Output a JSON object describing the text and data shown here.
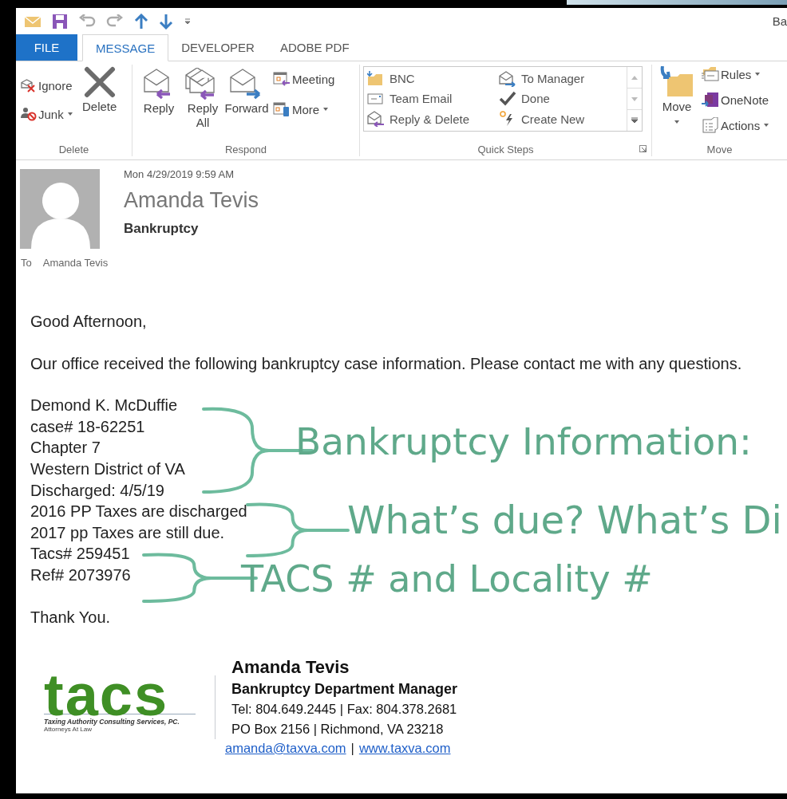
{
  "window": {
    "title": "Ba"
  },
  "tabs": [
    {
      "label": "FILE",
      "kind": "file",
      "selected": false
    },
    {
      "label": "MESSAGE",
      "kind": "tab",
      "selected": true
    },
    {
      "label": "DEVELOPER",
      "kind": "tab",
      "selected": false
    },
    {
      "label": "ADOBE PDF",
      "kind": "tab",
      "selected": false
    }
  ],
  "ribbon": {
    "groups": [
      {
        "label": "Delete",
        "kind": "buttons",
        "items": [
          {
            "label": "Ignore",
            "kind": "small",
            "dropdown": false
          },
          {
            "label": "Junk",
            "kind": "small",
            "dropdown": true
          },
          {
            "label": "Delete",
            "kind": "large",
            "dropdown": false
          }
        ]
      },
      {
        "label": "Respond",
        "kind": "buttons",
        "items": [
          {
            "label": "Reply",
            "kind": "large",
            "dropdown": false
          },
          {
            "label": "Reply All",
            "kind": "large",
            "dropdown": false
          },
          {
            "label": "Forward",
            "kind": "large",
            "dropdown": false
          },
          {
            "label": "Meeting",
            "kind": "small",
            "dropdown": false
          },
          {
            "label": "More",
            "kind": "small",
            "dropdown": true
          }
        ]
      },
      {
        "label": "Quick Steps",
        "kind": "gallery",
        "items": [
          {
            "label": "BNC"
          },
          {
            "label": "Team Email"
          },
          {
            "label": "Reply & Delete"
          },
          {
            "label": "To Manager"
          },
          {
            "label": "Done"
          },
          {
            "label": "Create New"
          }
        ]
      },
      {
        "label": "Move",
        "kind": "buttons",
        "items": [
          {
            "label": "Move",
            "kind": "large",
            "dropdown": true
          },
          {
            "label": "Rules",
            "kind": "small",
            "dropdown": true
          },
          {
            "label": "OneNote",
            "kind": "small",
            "dropdown": false
          },
          {
            "label": "Actions",
            "kind": "small",
            "dropdown": true
          }
        ]
      }
    ]
  },
  "message": {
    "date": "Mon 4/29/2019 9:59 AM",
    "sender": "Amanda Tevis",
    "subject": "Bankruptcy",
    "to_label": "To",
    "to": "Amanda Tevis"
  },
  "body": [
    [
      "Good Afternoon,"
    ],
    [
      "Our office received the following bankruptcy case information. Please contact me with any questions."
    ],
    [
      "Demond K. McDuffie",
      "case# 18-62251",
      "Chapter 7",
      "Western District of VA",
      "Discharged: 4/5/19",
      "2016 PP Taxes are discharged",
      "2017 pp Taxes are still due.",
      "Tacs# 259451",
      "Ref# 2073976"
    ],
    [
      "Thank You."
    ]
  ],
  "signature": {
    "logo": {
      "wordmark": "tacs",
      "tagline": "Taxing Authority Consulting Services, PC.",
      "subtitle": "Attorneys At Law"
    },
    "name": "Amanda Tevis",
    "title": "Bankruptcy Department Manager",
    "lines": [
      "Tel: 804.649.2445 | Fax: 804.378.2681",
      "PO Box 2156 | Richmond, VA 23218"
    ],
    "email": "amanda@taxva.com",
    "separator": "|",
    "website": "www.taxva.com"
  },
  "annotations": [
    {
      "text": "Bankruptcy Information:"
    },
    {
      "text": "What’s due? What’s Di"
    },
    {
      "text": "TACS # and Locality #"
    }
  ]
}
